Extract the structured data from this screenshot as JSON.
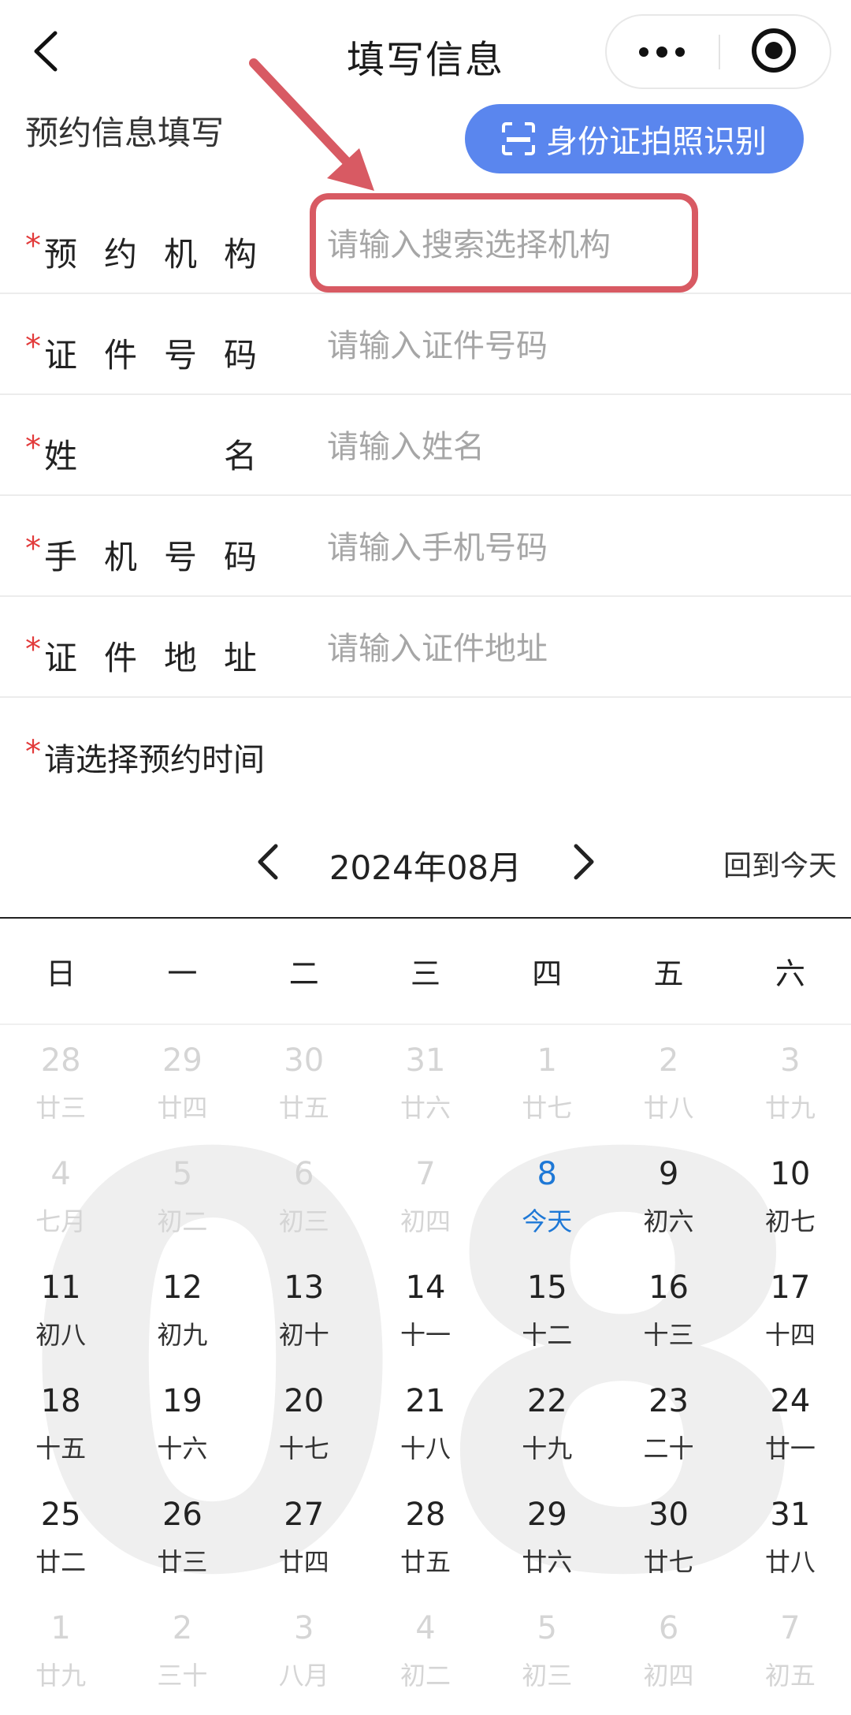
{
  "nav": {
    "title": "填写信息"
  },
  "section": {
    "title": "预约信息填写",
    "id_button_label": "身份证拍照识别"
  },
  "form": {
    "required_mark": "*",
    "fields": [
      {
        "label_chars": [
          "预",
          "约",
          "机",
          "构"
        ],
        "placeholder": "请输入搜索选择机构",
        "value": ""
      },
      {
        "label_chars": [
          "证",
          "件",
          "号",
          "码"
        ],
        "placeholder": "请输入证件号码",
        "value": ""
      },
      {
        "label_chars": [
          "姓",
          "名"
        ],
        "placeholder": "请输入姓名",
        "value": ""
      },
      {
        "label_chars": [
          "手",
          "机",
          "号",
          "码"
        ],
        "placeholder": "请输入手机号码",
        "value": ""
      },
      {
        "label_chars": [
          "证",
          "件",
          "地",
          "址"
        ],
        "placeholder": "请输入证件地址",
        "value": ""
      }
    ],
    "time_label": "请选择预约时间"
  },
  "calendar": {
    "month_title": "2024年08月",
    "today_button": "回到今天",
    "watermark": "08",
    "weekdays": [
      "日",
      "一",
      "二",
      "三",
      "四",
      "五",
      "六"
    ],
    "days": [
      {
        "d": "28",
        "l": "廿三",
        "other": true
      },
      {
        "d": "29",
        "l": "廿四",
        "other": true
      },
      {
        "d": "30",
        "l": "廿五",
        "other": true
      },
      {
        "d": "31",
        "l": "廿六",
        "other": true
      },
      {
        "d": "1",
        "l": "廿七",
        "other": true
      },
      {
        "d": "2",
        "l": "廿八",
        "other": true
      },
      {
        "d": "3",
        "l": "廿九",
        "other": true
      },
      {
        "d": "4",
        "l": "七月",
        "other": true
      },
      {
        "d": "5",
        "l": "初二",
        "other": true
      },
      {
        "d": "6",
        "l": "初三",
        "other": true
      },
      {
        "d": "7",
        "l": "初四",
        "other": true
      },
      {
        "d": "8",
        "l": "今天",
        "today": true
      },
      {
        "d": "9",
        "l": "初六"
      },
      {
        "d": "10",
        "l": "初七"
      },
      {
        "d": "11",
        "l": "初八"
      },
      {
        "d": "12",
        "l": "初九"
      },
      {
        "d": "13",
        "l": "初十"
      },
      {
        "d": "14",
        "l": "十一"
      },
      {
        "d": "15",
        "l": "十二"
      },
      {
        "d": "16",
        "l": "十三"
      },
      {
        "d": "17",
        "l": "十四"
      },
      {
        "d": "18",
        "l": "十五"
      },
      {
        "d": "19",
        "l": "十六"
      },
      {
        "d": "20",
        "l": "十七"
      },
      {
        "d": "21",
        "l": "十八"
      },
      {
        "d": "22",
        "l": "十九"
      },
      {
        "d": "23",
        "l": "二十"
      },
      {
        "d": "24",
        "l": "廿一"
      },
      {
        "d": "25",
        "l": "廿二"
      },
      {
        "d": "26",
        "l": "廿三"
      },
      {
        "d": "27",
        "l": "廿四"
      },
      {
        "d": "28",
        "l": "廿五"
      },
      {
        "d": "29",
        "l": "廿六"
      },
      {
        "d": "30",
        "l": "廿七"
      },
      {
        "d": "31",
        "l": "廿八"
      },
      {
        "d": "1",
        "l": "廿九",
        "other": true
      },
      {
        "d": "2",
        "l": "三十",
        "other": true
      },
      {
        "d": "3",
        "l": "八月",
        "other": true
      },
      {
        "d": "4",
        "l": "初二",
        "other": true
      },
      {
        "d": "5",
        "l": "初三",
        "other": true
      },
      {
        "d": "6",
        "l": "初四",
        "other": true
      },
      {
        "d": "7",
        "l": "初五",
        "other": true
      }
    ]
  },
  "colors": {
    "accent_blue": "#5a86ee",
    "required_red": "#e23b3b",
    "annotation_red": "#d85a63",
    "today_blue": "#1e78d6"
  }
}
